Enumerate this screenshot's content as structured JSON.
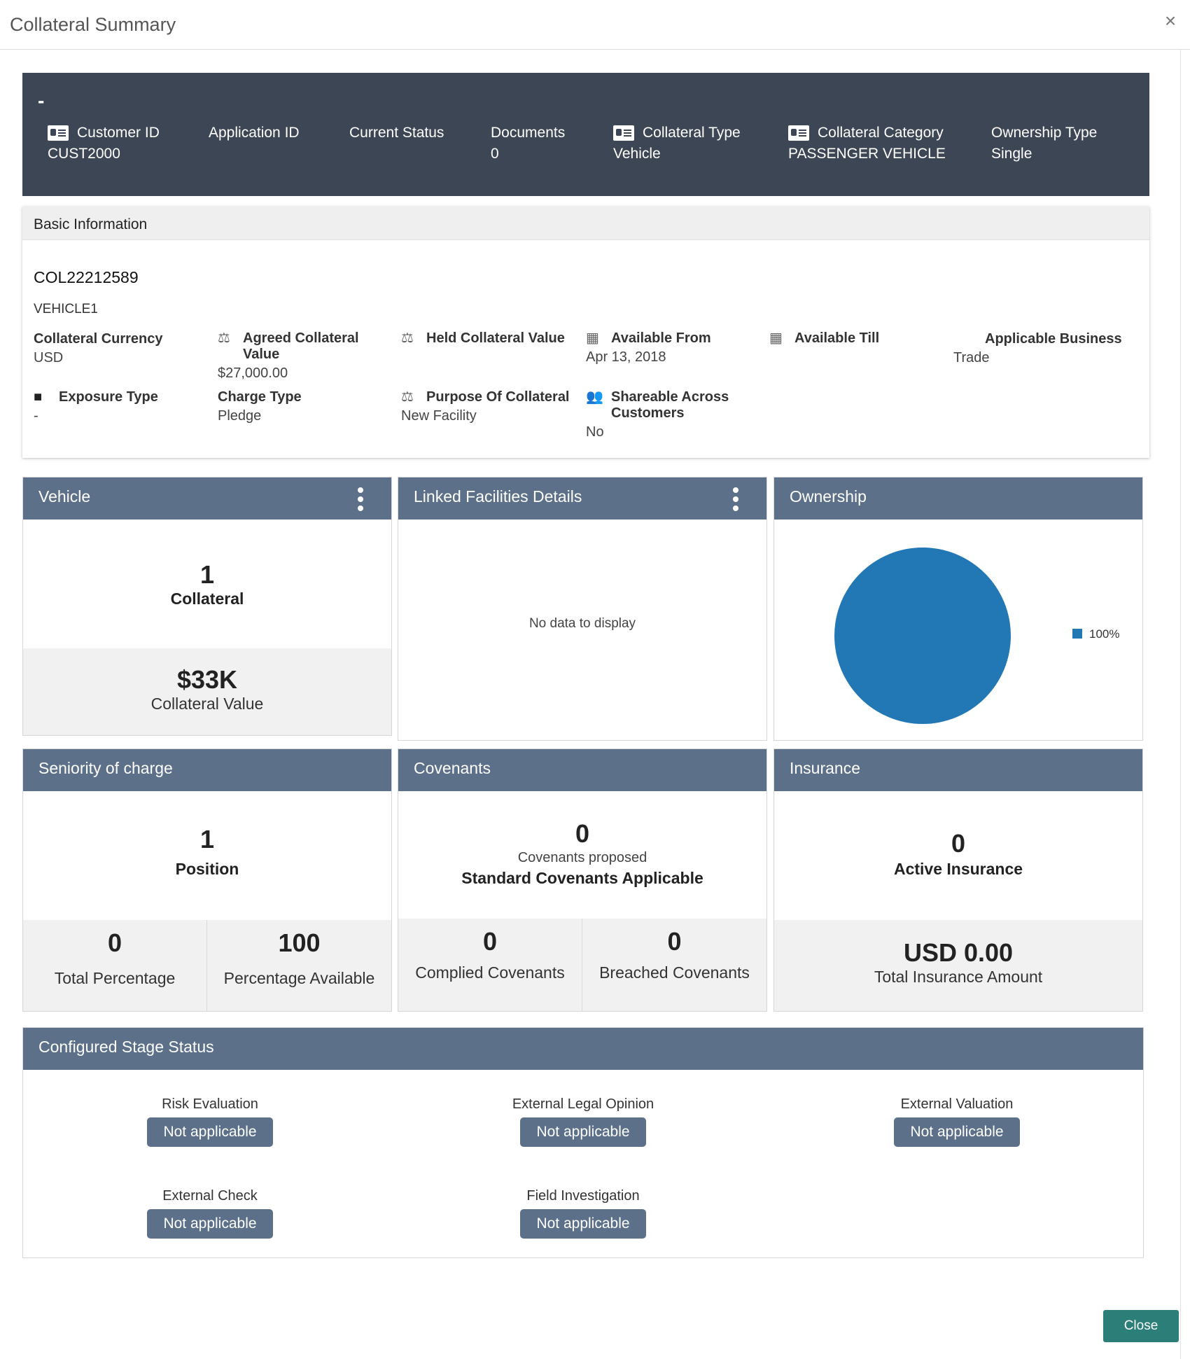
{
  "modal": {
    "title": "Collateral Summary",
    "close_glyph": "×",
    "close_button": "Close"
  },
  "header": {
    "dash": "-",
    "items": [
      {
        "label": "Customer ID",
        "value": "CUST2000",
        "icon": "id-card-icon"
      },
      {
        "label": "Application ID",
        "value": ""
      },
      {
        "label": "Current Status",
        "value": ""
      },
      {
        "label": "Documents",
        "value": "0"
      },
      {
        "label": "Collateral Type",
        "value": "Vehicle",
        "icon": "id-card-icon"
      },
      {
        "label": "Collateral Category",
        "value": "PASSENGER VEHICLE",
        "icon": "id-card-icon"
      },
      {
        "label": "Ownership Type",
        "value": "Single"
      }
    ]
  },
  "basic": {
    "title": "Basic Information",
    "id": "COL22212589",
    "name": "VEHICLE1",
    "fields": {
      "collateral_currency": {
        "label": "Collateral Currency",
        "value": "USD"
      },
      "agreed_value": {
        "label": "Agreed Collateral Value",
        "value": "$27,000.00"
      },
      "held_value": {
        "label": "Held Collateral Value",
        "value": ""
      },
      "available_from": {
        "label": "Available From",
        "value": "Apr 13, 2018"
      },
      "available_till": {
        "label": "Available Till",
        "value": ""
      },
      "applicable_business": {
        "label": "Applicable Business",
        "value": "Trade"
      },
      "exposure_type": {
        "label": "Exposure Type",
        "value": "-"
      },
      "charge_type": {
        "label": "Charge Type",
        "value": "Pledge"
      },
      "purpose": {
        "label": "Purpose Of Collateral",
        "value": "New Facility"
      },
      "shareable": {
        "label": "Shareable Across Customers",
        "value": "No"
      }
    }
  },
  "cards": {
    "vehicle": {
      "title": "Vehicle",
      "count": "1",
      "count_label": "Collateral",
      "value": "$33K",
      "value_label": "Collateral Value"
    },
    "linked": {
      "title": "Linked Facilities Details",
      "empty": "No data to display"
    },
    "ownership": {
      "title": "Ownership",
      "legend": "100%",
      "color": "#2278b5"
    },
    "seniority": {
      "title": "Seniority of charge",
      "count": "1",
      "count_label": "Position",
      "left_value": "0",
      "left_label": "Total Percentage",
      "right_value": "100",
      "right_label": "Percentage Available"
    },
    "covenants": {
      "title": "Covenants",
      "count": "0",
      "count_label": "Covenants proposed",
      "sub_label": "Standard Covenants Applicable",
      "left_value": "0",
      "left_label": "Complied Covenants",
      "right_value": "0",
      "right_label": "Breached Covenants"
    },
    "insurance": {
      "title": "Insurance",
      "count": "0",
      "count_label": "Active Insurance",
      "value": "USD 0.00",
      "value_label": "Total Insurance Amount"
    }
  },
  "stage": {
    "title": "Configured Stage Status",
    "items": [
      {
        "name": "Risk Evaluation",
        "status": "Not applicable"
      },
      {
        "name": "External Legal Opinion",
        "status": "Not applicable"
      },
      {
        "name": "External Valuation",
        "status": "Not applicable"
      },
      {
        "name": "External Check",
        "status": "Not applicable"
      },
      {
        "name": "Field Investigation",
        "status": "Not applicable"
      }
    ]
  },
  "chart_data": {
    "type": "pie",
    "categories": [
      "100%"
    ],
    "values": [
      100
    ],
    "colors": [
      "#2278b5"
    ],
    "legend": "right"
  }
}
